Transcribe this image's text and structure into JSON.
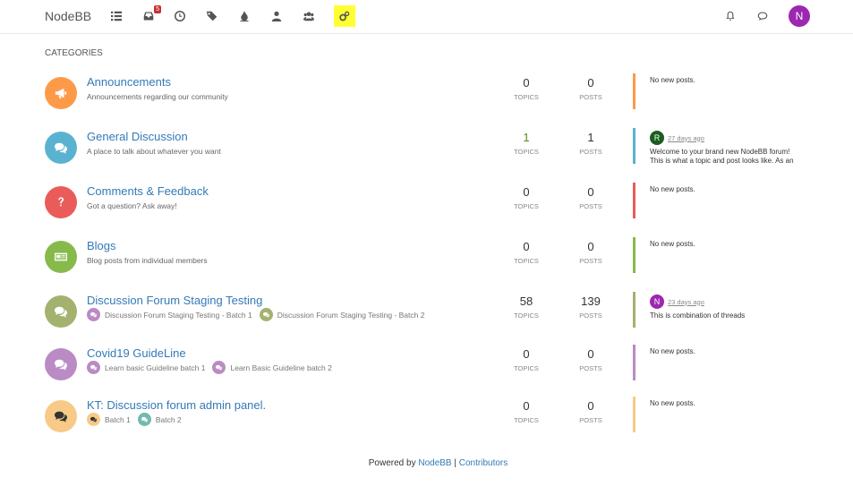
{
  "brand": "NodeBB",
  "nav": {
    "notifications_count": "5",
    "user_initial": "N"
  },
  "section_title": "CATEGORIES",
  "labels": {
    "topics": "TOPICS",
    "posts": "POSTS"
  },
  "categories": [
    {
      "title": "Announcements",
      "description": "Announcements regarding our community",
      "icon": "bullhorn-icon",
      "color": "#fd9a48",
      "topics": "0",
      "posts": "0",
      "teaser": {
        "text": "No new posts."
      }
    },
    {
      "title": "General Discussion",
      "description": "A place to talk about whatever you want",
      "icon": "comments-icon",
      "color": "#59b3d0",
      "topics": "1",
      "posts": "1",
      "teaser": {
        "avatar": "R",
        "avatar_color": "#1b5e20",
        "time": "27 days ago",
        "line1": "Welcome to your brand new NodeBB forum!",
        "line2": "This is what a topic and post looks like. As an"
      }
    },
    {
      "title": "Comments & Feedback",
      "description": "Got a question? Ask away!",
      "icon": "question-icon",
      "color": "#e95c5a",
      "topics": "0",
      "posts": "0",
      "teaser": {
        "text": "No new posts."
      }
    },
    {
      "title": "Blogs",
      "description": "Blog posts from individual members",
      "icon": "newspaper-icon",
      "color": "#86ba4b",
      "topics": "0",
      "posts": "0",
      "teaser": {
        "text": "No new posts."
      }
    },
    {
      "title": "Discussion Forum Staging Testing",
      "icon": "comments-icon",
      "color": "#a3b26f",
      "subcategories": [
        {
          "label": "Discussion Forum Staging Testing - Batch 1",
          "color": "#ba8bc4"
        },
        {
          "label": "Discussion Forum Staging Testing - Batch 2",
          "color": "#a3b26f"
        }
      ],
      "topics": "58",
      "posts": "139",
      "teaser": {
        "avatar": "N",
        "avatar_color": "#9c27b0",
        "time": "23 days ago",
        "line1": "This is combination of threads"
      }
    },
    {
      "title": "Covid19 GuideLine",
      "icon": "comments-icon",
      "color": "#ba8bc4",
      "subcategories": [
        {
          "label": "Learn basic Guideline batch 1",
          "color": "#ba8bc4"
        },
        {
          "label": "Learn Basic Guideline batch 2",
          "color": "#ba8bc4"
        }
      ],
      "topics": "0",
      "posts": "0",
      "teaser": {
        "text": "No new posts."
      }
    },
    {
      "title": "KT: Discussion forum admin panel.",
      "icon": "comments-icon",
      "color": "#f7ca88",
      "subcategories": [
        {
          "label": "Batch 1",
          "color": "#f7ca88"
        },
        {
          "label": "Batch 2",
          "color": "#73b9b0"
        }
      ],
      "topics": "0",
      "posts": "0",
      "teaser": {
        "text": "No new posts."
      }
    }
  ],
  "footer": {
    "prefix": "Powered by ",
    "nodebb_link": "NodeBB",
    "separator": " | ",
    "contributors_link": "Contributors"
  }
}
